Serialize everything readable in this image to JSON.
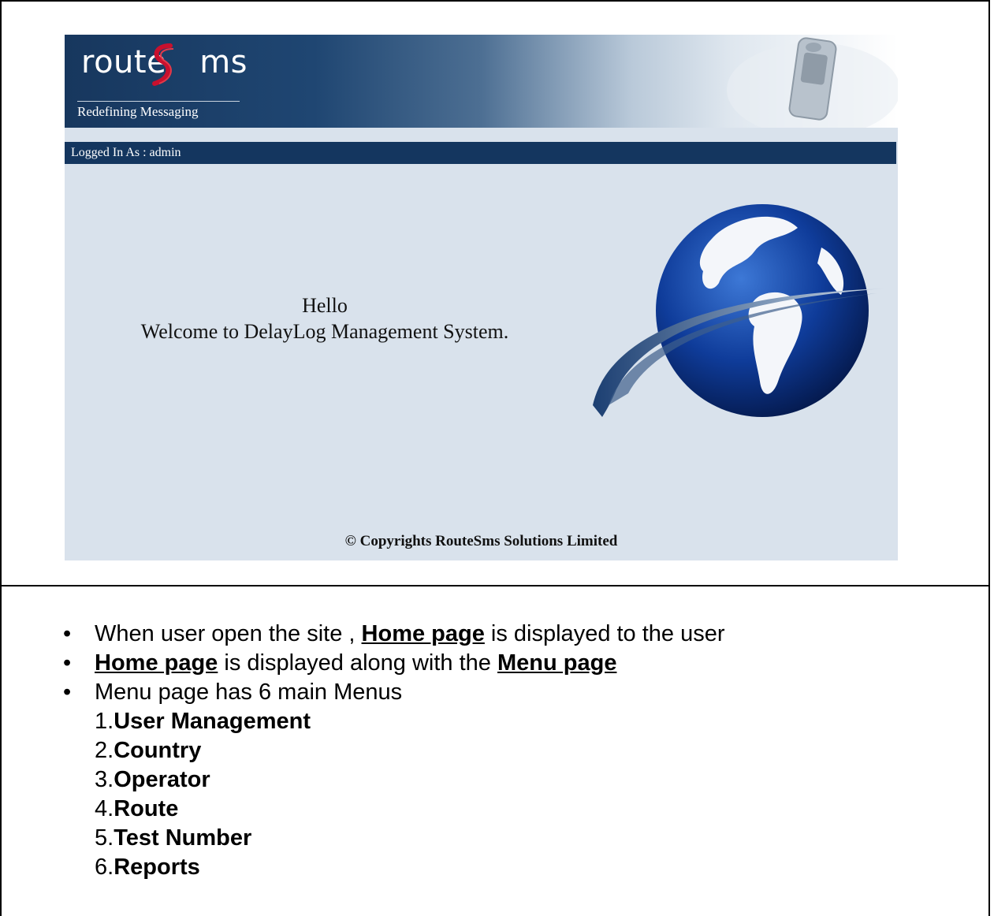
{
  "banner": {
    "logo_left": "route",
    "logo_right": "ms",
    "tagline": "Redefining Messaging"
  },
  "login": {
    "text": "Logged In As : admin"
  },
  "welcome": {
    "line1": "Hello",
    "line2": "Welcome to DelayLog Management System."
  },
  "footer": {
    "copyright": "© Copyrights RouteSms Solutions Limited"
  },
  "notes": {
    "bullet1_pre": "When user open the site , ",
    "bullet1_link": "Home page",
    "bullet1_post": " is displayed to the user",
    "bullet2_link1": "Home page",
    "bullet2_mid": " is displayed along with the ",
    "bullet2_link2": "Menu page",
    "bullet3": "Menu page has 6 main Menus",
    "menus": [
      {
        "num": "1.",
        "label": "User Management"
      },
      {
        "num": "2.",
        "label": "Country"
      },
      {
        "num": "3.",
        "label": "Operator"
      },
      {
        "num": "4.",
        "label": "Route"
      },
      {
        "num": "5.",
        "label": "Test Number"
      },
      {
        "num": "6.",
        "label": "Reports"
      }
    ]
  },
  "colors": {
    "banner_dark": "#17375e",
    "login_bar": "#14365f",
    "content_bg": "#d9e2ec",
    "logo_red": "#c8102e"
  }
}
